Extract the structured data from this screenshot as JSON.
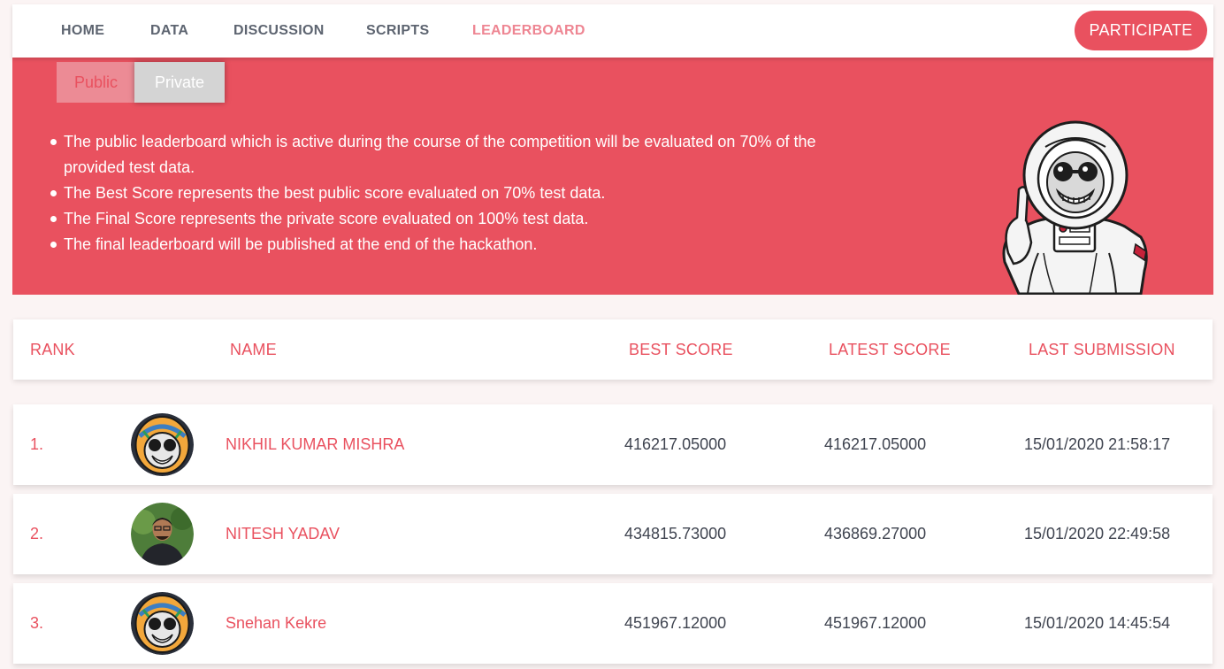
{
  "nav": {
    "items": [
      {
        "label": "HOME",
        "name": "nav-home"
      },
      {
        "label": "DATA",
        "name": "nav-data"
      },
      {
        "label": "DISCUSSION",
        "name": "nav-discussion"
      },
      {
        "label": "SCRIPTS",
        "name": "nav-scripts"
      },
      {
        "label": "LEADERBOARD",
        "name": "nav-leaderboard"
      }
    ],
    "active": "LEADERBOARD",
    "participate_label": "PARTICIPATE"
  },
  "banner": {
    "tabs": {
      "public": "Public",
      "private": "Private"
    },
    "rules": [
      "The public leaderboard which is active during the course of the competition will be evaluated on 70% of the provided test data.",
      "The Best Score represents the best public score evaluated on 70% test data.",
      "The Final Score represents the private score evaluated on 100% test data.",
      "The final leaderboard will be published at the end of the hackathon."
    ],
    "mascot_icon": "astronaut-monkey-illustration"
  },
  "table": {
    "headers": {
      "rank": "RANK",
      "name": "NAME",
      "best": "BEST SCORE",
      "latest": "LATEST SCORE",
      "last": "LAST SUBMISSION"
    },
    "rows": [
      {
        "rank": "1.",
        "name": "NIKHIL KUMAR MISHRA",
        "best": "416217.05000",
        "latest": "416217.05000",
        "last": "15/01/2020 21:58:17",
        "avatar": "helmet-monkey-avatar"
      },
      {
        "rank": "2.",
        "name": "NITESH YADAV",
        "best": "434815.73000",
        "latest": "436869.27000",
        "last": "15/01/2020 22:49:58",
        "avatar": "person-photo-avatar"
      },
      {
        "rank": "3.",
        "name": "Snehan Kekre",
        "best": "451967.12000",
        "latest": "451967.12000",
        "last": "15/01/2020 14:45:54",
        "avatar": "helmet-monkey-avatar"
      }
    ]
  },
  "colors": {
    "accent": "#e9515f",
    "nav_text": "#5d6470",
    "active_nav": "#ee8592",
    "body_text": "#3f4450",
    "page_bg": "#fbf4f4"
  }
}
